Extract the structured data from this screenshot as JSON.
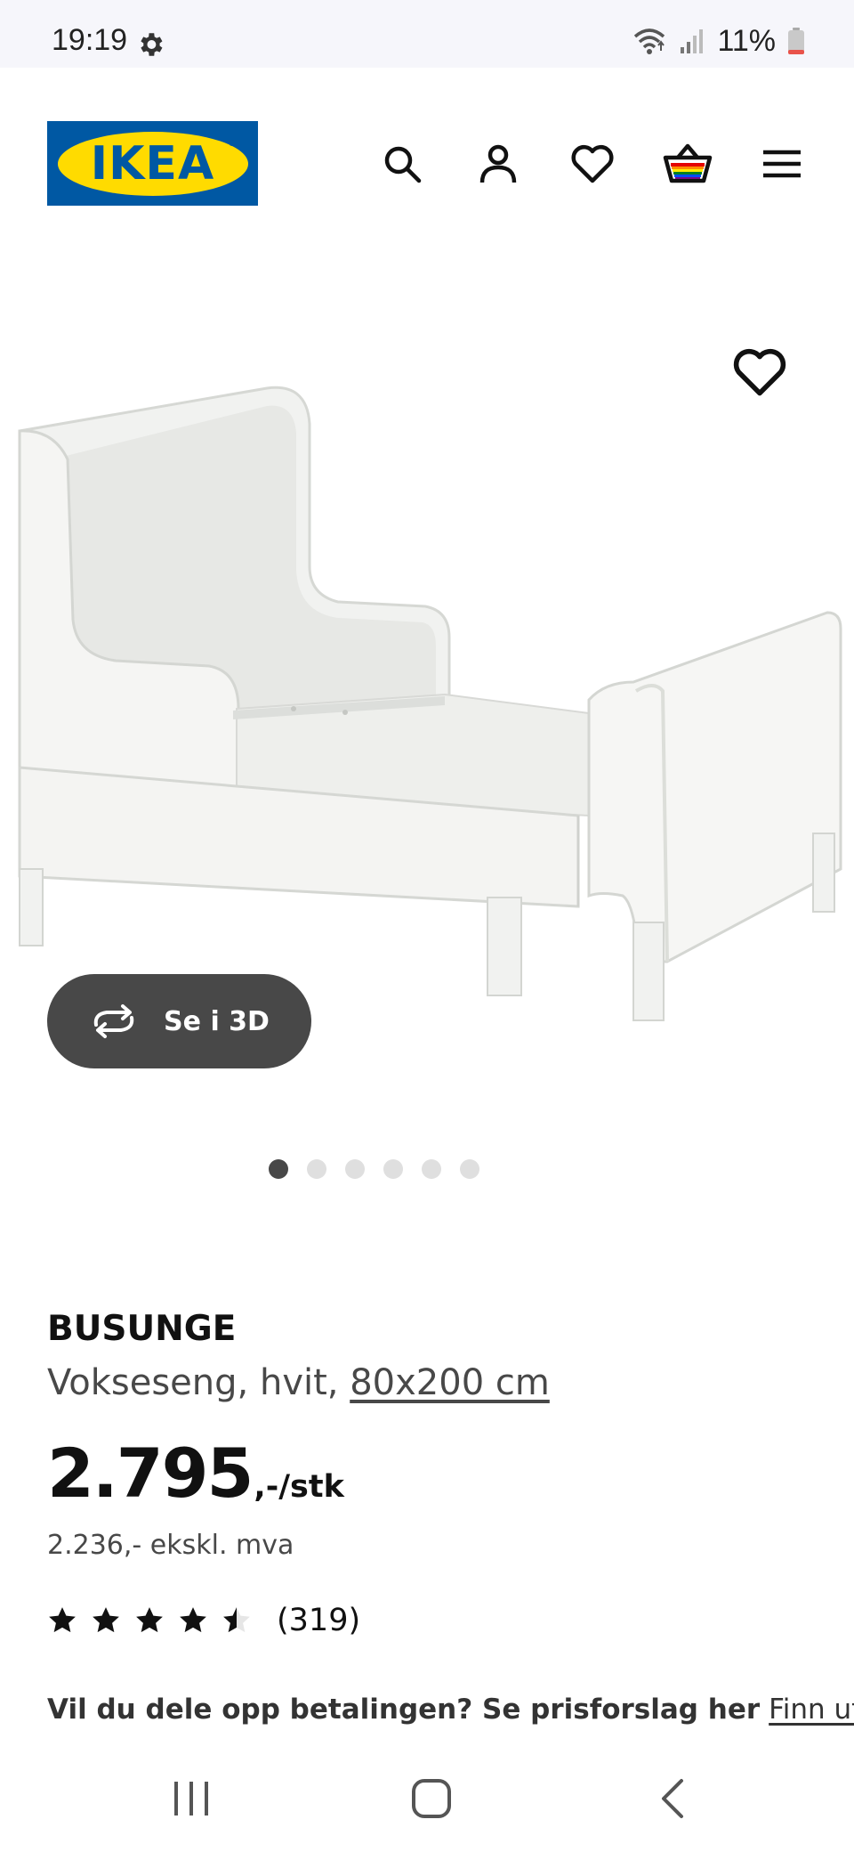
{
  "status_bar": {
    "time": "19:19",
    "battery": "11%",
    "icons": [
      "gear-icon",
      "wifi-icon",
      "signal-icon",
      "battery-icon"
    ]
  },
  "header": {
    "logo_text": "IKEA",
    "icons": [
      "search-icon",
      "account-icon",
      "heart-icon",
      "basket-icon",
      "menu-icon"
    ]
  },
  "hero": {
    "button_3d_label": "Se i 3D",
    "carousel_total": 6,
    "carousel_active": 1
  },
  "product": {
    "name": "BUSUNGE",
    "description": "Vokseseng, hvit, ",
    "size_link": "80x200 cm",
    "price": "2.795",
    "price_suffix": ",-/stk",
    "price_ex_vat": "2.236,- ekskl. mva",
    "rating_value": 4.5,
    "rating_max": 5,
    "rating_count": "(319)",
    "installment_text": "Vil du dele opp betalingen? Se prisforslag her",
    "installment_link": "Finn ut"
  },
  "colors": {
    "ikea_blue": "#0058a3",
    "ikea_yellow": "#ffdb00",
    "button_dark": "#484848"
  }
}
